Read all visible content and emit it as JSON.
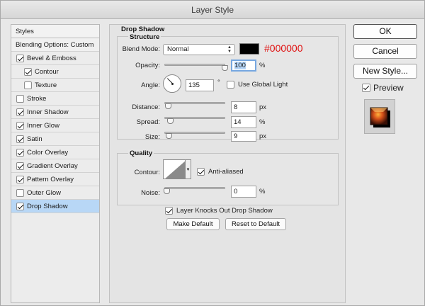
{
  "window": {
    "title": "Layer Style"
  },
  "styles_list": {
    "header": "Styles",
    "blending": "Blending Options: Custom",
    "items": [
      {
        "label": "Bevel & Emboss",
        "checked": true
      },
      {
        "label": "Contour",
        "checked": true
      },
      {
        "label": "Texture",
        "checked": false
      },
      {
        "label": "Stroke",
        "checked": false
      },
      {
        "label": "Inner Shadow",
        "checked": true
      },
      {
        "label": "Inner Glow",
        "checked": true
      },
      {
        "label": "Satin",
        "checked": true
      },
      {
        "label": "Color Overlay",
        "checked": true
      },
      {
        "label": "Gradient Overlay",
        "checked": true
      },
      {
        "label": "Pattern Overlay",
        "checked": true
      },
      {
        "label": "Outer Glow",
        "checked": false
      },
      {
        "label": "Drop Shadow",
        "checked": true
      }
    ]
  },
  "drop_shadow": {
    "group_title": "Drop Shadow",
    "structure_title": "Structure",
    "blend_mode_label": "Blend Mode:",
    "blend_mode_value": "Normal",
    "color_hex": "#000000",
    "color_annotation": "#000000",
    "opacity_label": "Opacity:",
    "opacity_value": "100",
    "opacity_fraction": 1.0,
    "percent": "%",
    "angle_label": "Angle:",
    "angle_value": "135",
    "degree": "°",
    "use_global_light": "Use Global Light",
    "use_global_light_checked": false,
    "distance_label": "Distance:",
    "distance_value": "8",
    "spread_label": "Spread:",
    "spread_value": "14",
    "size_label": "Size:",
    "size_value": "9",
    "px": "px",
    "quality_title": "Quality",
    "contour_label": "Contour:",
    "anti_aliased": "Anti-aliased",
    "anti_aliased_checked": true,
    "noise_label": "Noise:",
    "noise_value": "0",
    "layer_knocks_out": "Layer Knocks Out Drop Shadow",
    "layer_knocks_out_checked": true,
    "make_default": "Make Default",
    "reset_default": "Reset to Default"
  },
  "actions": {
    "ok": "OK",
    "cancel": "Cancel",
    "new_style": "New Style...",
    "preview": "Preview",
    "preview_checked": true
  }
}
